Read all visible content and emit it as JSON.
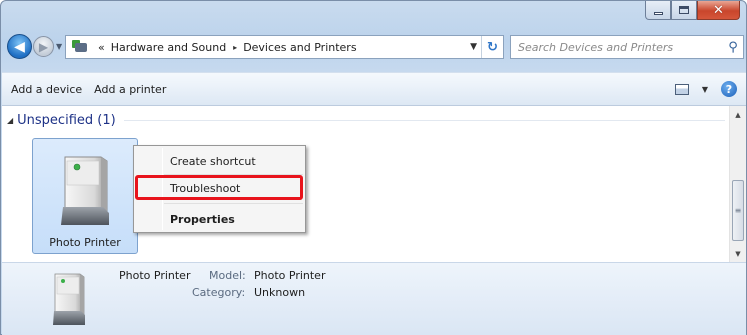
{
  "window": {
    "title_buttons": [
      "minimize",
      "maximize",
      "close"
    ],
    "close_glyph": "✕"
  },
  "nav": {
    "back_icon": "back-arrow-icon",
    "forward_icon": "forward-arrow-icon",
    "breadcrumb": {
      "overflow": "«",
      "segments": [
        "Hardware and Sound",
        "Devices and Printers"
      ],
      "separator": "▸"
    },
    "search_placeholder": "Search Devices and Printers"
  },
  "toolbar": {
    "add_device": "Add a device",
    "add_printer": "Add a printer",
    "help_glyph": "?"
  },
  "content": {
    "group_label": "Unspecified (1)",
    "device_label": "Photo Printer"
  },
  "context_menu": {
    "items": [
      "Create shortcut",
      "Troubleshoot",
      "Properties"
    ],
    "highlighted_item": "Troubleshoot",
    "highlight_color": "#e8141c"
  },
  "details": {
    "name": "Photo Printer",
    "model_label": "Model:",
    "model_value": "Photo Printer",
    "category_label": "Category:",
    "category_value": "Unknown"
  },
  "colors": {
    "selection_bg": "#cce3fb",
    "link_blue": "#1e3287",
    "frame": "#bcd3ec"
  }
}
